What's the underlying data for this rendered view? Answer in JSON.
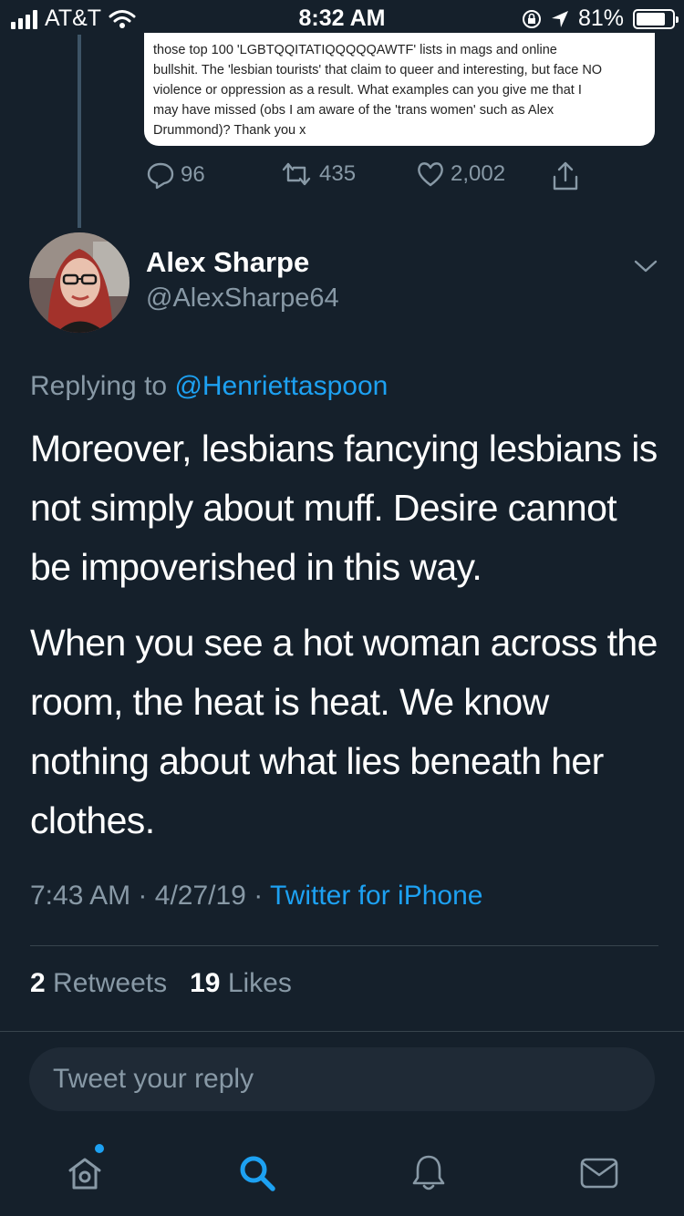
{
  "status_bar": {
    "carrier": "AT&T",
    "time": "8:32 AM",
    "battery": "81%",
    "battery_level": 0.81
  },
  "previous_tweet": {
    "image_text_lines": [
      "those top 100 'LGBTQQITATIQQQQQAWTF' lists in mags and online",
      "bullshit. The 'lesbian tourists' that claim to queer and interesting, but face NO",
      "violence or oppression as a result. What examples can you give me that I",
      "may have missed (obs I am aware of the 'trans women' such as Alex",
      "Drummond)? Thank you x"
    ],
    "replies": "96",
    "retweets": "435",
    "likes": "2,002"
  },
  "tweet": {
    "author_name": "Alex Sharpe",
    "author_handle": "@AlexSharpe64",
    "replying_prefix": "Replying to",
    "replying_to": "@Henriettaspoon",
    "paragraphs": [
      "Moreover, lesbians fancying lesbians is not simply about muff. Desire cannot be impoverished in this way.",
      "When you see a hot woman across the room, the heat is heat. We know nothing about what lies beneath her clothes."
    ],
    "time": "7:43 AM",
    "date": "4/27/19",
    "separator": "·",
    "source": "Twitter for iPhone",
    "retweet_count": "2",
    "retweet_label": "Retweets",
    "like_count": "19",
    "like_label": "Likes"
  },
  "reply": {
    "placeholder": "Tweet your reply"
  },
  "tabbar": {
    "items": [
      "home-icon",
      "search-icon",
      "notifications-icon",
      "messages-icon"
    ],
    "active": "search-icon"
  },
  "colors": {
    "background": "#15202b",
    "accent": "#1da1f2",
    "secondary_text": "#8899a6",
    "divider": "#38444d"
  }
}
